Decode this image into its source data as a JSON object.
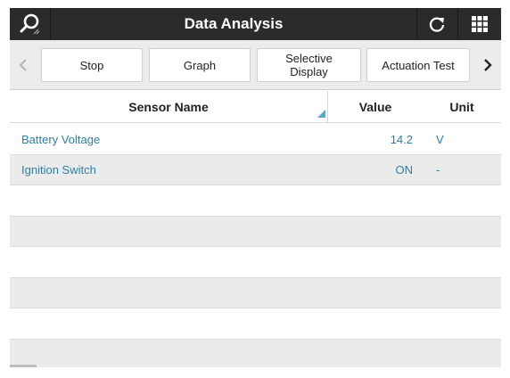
{
  "titlebar": {
    "title": "Data Analysis",
    "search_icon": "search-icon",
    "refresh_icon": "refresh-icon",
    "grid_icon": "grid-menu-icon"
  },
  "toolbar": {
    "prev_icon": "chevron-left-icon",
    "next_icon": "chevron-right-icon",
    "buttons": [
      {
        "label": "Stop"
      },
      {
        "label": "Graph"
      },
      {
        "label": "Selective\nDisplay"
      },
      {
        "label": "Actuation Test"
      }
    ]
  },
  "table": {
    "columns": [
      "Sensor Name",
      "Value",
      "Unit"
    ],
    "rows": [
      {
        "name": "Battery Voltage",
        "value": "14.2",
        "unit": "V"
      },
      {
        "name": "Ignition Switch",
        "value": "ON",
        "unit": "-"
      },
      {
        "name": "",
        "value": "",
        "unit": ""
      },
      {
        "name": "",
        "value": "",
        "unit": ""
      },
      {
        "name": "",
        "value": "",
        "unit": ""
      },
      {
        "name": "",
        "value": "",
        "unit": ""
      },
      {
        "name": "",
        "value": "",
        "unit": ""
      },
      {
        "name": "",
        "value": "",
        "unit": ""
      }
    ]
  },
  "colors": {
    "titlebar_bg": "#2b2b2b",
    "toolbar_bg": "#ececec",
    "value_text": "#2c7fa8",
    "alt_row": "#ebebeb",
    "sort_indicator": "#5aa9c9"
  }
}
